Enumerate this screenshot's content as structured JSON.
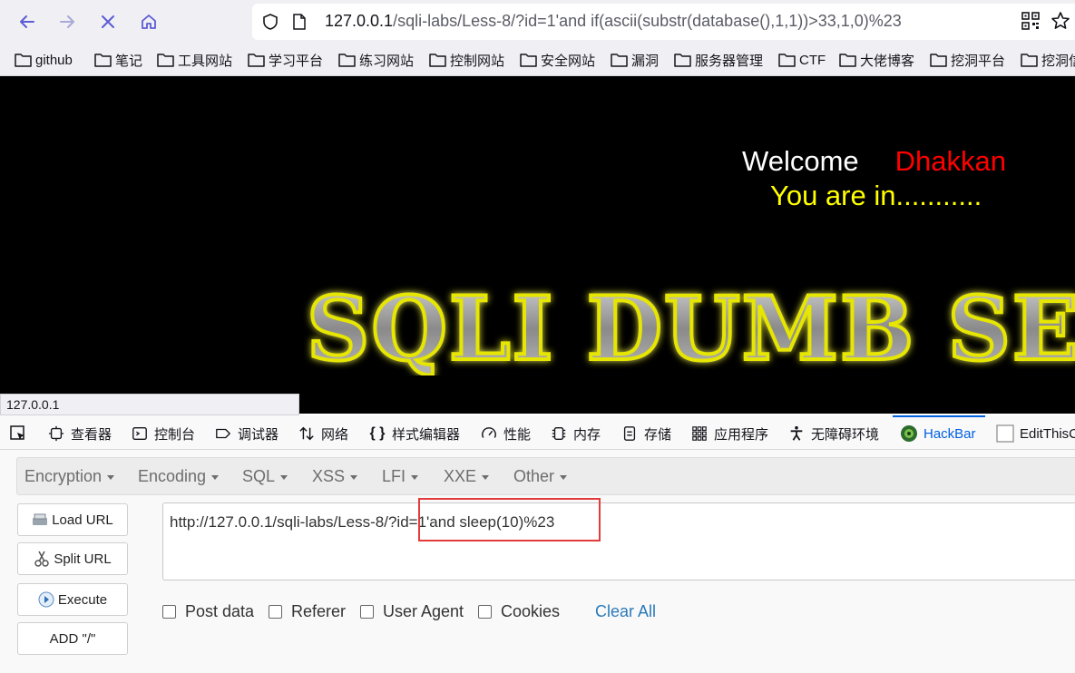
{
  "browser": {
    "url_host": "127.0.0.1",
    "url_rest": "/sqli-labs/Less-8/?id=1'and if(ascii(substr(database(),1,1))>33,1,0)%23",
    "status_url": "127.0.0.1"
  },
  "bookmarks": [
    "github",
    "笔记",
    "工具网站",
    "学习平台",
    "练习网站",
    "控制网站",
    "安全网站",
    "漏洞",
    "服务器管理",
    "CTF",
    "大佬博客",
    "挖洞平台",
    "挖洞信"
  ],
  "page": {
    "welcome": "Welcome",
    "name": "Dhakkan",
    "you_are_in": "You are in...........",
    "banner": "SQLI DUMB SE"
  },
  "devtools": {
    "tabs": [
      "查看器",
      "控制台",
      "调试器",
      "网络",
      "样式编辑器",
      "性能",
      "内存",
      "存储",
      "应用程序",
      "无障碍环境",
      "HackBar",
      "EditThisC"
    ],
    "active_tab": "HackBar"
  },
  "hackbar": {
    "menus": [
      "Encryption",
      "Encoding",
      "SQL",
      "XSS",
      "LFI",
      "XXE",
      "Other"
    ],
    "buttons": {
      "load_url": "Load URL",
      "split_url": "Split URL",
      "execute": "Execute",
      "add_slash": "ADD \"/\""
    },
    "url_value": "http://127.0.0.1/sqli-labs/Less-8/?id=1'and sleep(10)%23",
    "options": [
      "Post data",
      "Referer",
      "User Agent",
      "Cookies"
    ],
    "clear_all": "Clear All"
  },
  "colors": {
    "highlight_box": "#e33b3b",
    "welcome_name": "#ff0000",
    "you_are_in": "#ffff00",
    "active_tab": "#0060df"
  }
}
